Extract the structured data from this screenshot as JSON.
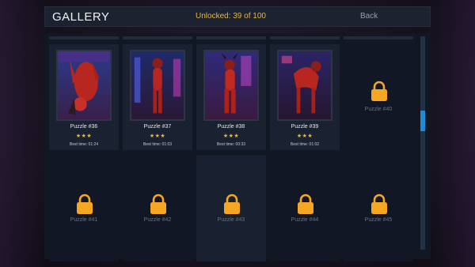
{
  "header": {
    "title": "GALLERY",
    "unlocked": "Unlocked: 39 of 100",
    "back_label": "Back"
  },
  "unlocked_cards": [
    {
      "name": "Puzzle #36",
      "stars": "★★★",
      "best": "Best time: 01:24"
    },
    {
      "name": "Puzzle #37",
      "stars": "★★★",
      "best": "Best time: 01:03"
    },
    {
      "name": "Puzzle #38",
      "stars": "★★★",
      "best": "Best time: 00:33"
    },
    {
      "name": "Puzzle #39",
      "stars": "★★★",
      "best": "Best time: 01:02"
    }
  ],
  "locked_cards": [
    {
      "name": "Puzzle #40"
    },
    {
      "name": "Puzzle #41"
    },
    {
      "name": "Puzzle #42"
    },
    {
      "name": "Puzzle #43"
    },
    {
      "name": "Puzzle #44"
    },
    {
      "name": "Puzzle #45"
    }
  ],
  "colors": {
    "accent_gold": "#e2b64a",
    "star": "#f0b93a",
    "lock": "#f5a623",
    "scroll_thumb": "#1e8bd6"
  },
  "icons": {
    "lock": "padlock-icon",
    "thumbnail": "artwork-thumbnail"
  }
}
